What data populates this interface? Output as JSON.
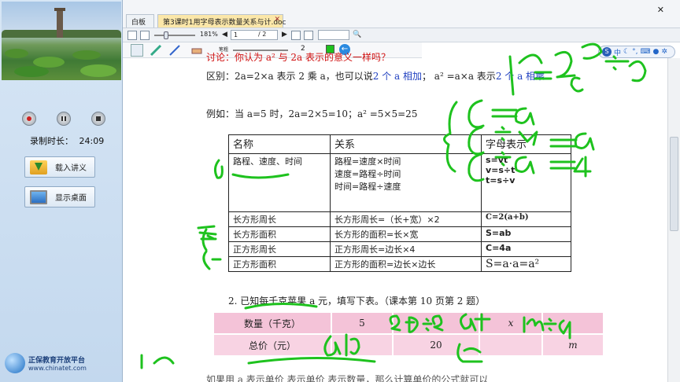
{
  "left_panel": {
    "rec_time_label": "录制时长：",
    "rec_time_value": "24:09",
    "load_button": "载入讲义",
    "desktop_button": "显示桌面",
    "logo_title": "正保教育开放平台",
    "logo_url": "www.chinatet.com"
  },
  "tabs": [
    {
      "label": "白板"
    },
    {
      "label": "第3课时1用字母表示数量关系与计.doc"
    }
  ],
  "toolbar": {
    "zoom": "181%",
    "page_current": "1",
    "page_total": "/ 2",
    "pen_size": "2",
    "small_label": "笔粗"
  },
  "ime": {
    "label": "中"
  },
  "doc": {
    "discussion": "讨论：你认为 a² 与 2a 表示的意义一样吗？",
    "diff_prefix": "区别：2a=2×a 表示 2 乘 a，也可以说",
    "diff_blue": "2 个 a 相加",
    "diff_mid": "；   a² =a×a 表示",
    "diff_blue2": "2 个 a 相乘",
    "example": "例如：当 a=5 时，2a=2×5=10；a² =5×5=25",
    "table_headers": [
      "名称",
      "关系",
      "字母表示"
    ],
    "rows": [
      {
        "name": "路程、速度、时间",
        "rel": [
          "路程=速度×时间",
          "速度=路程÷时间",
          "时间=路程÷速度"
        ],
        "formula": [
          "s=vt",
          "v=s÷t",
          "t=s÷v"
        ]
      },
      {
        "name": "长方形周长",
        "rel": [
          "长方形周长=（长+宽）×2"
        ],
        "formula": [
          "C=2(a+b)"
        ]
      },
      {
        "name": "长方形面积",
        "rel": [
          "长方形的面积=长×宽"
        ],
        "formula": [
          "S=ab"
        ]
      },
      {
        "name": "正方形周长",
        "rel": [
          "正方形周长=边长×4"
        ],
        "formula": [
          "C=4a"
        ]
      },
      {
        "name": "正方形面积",
        "rel": [
          "正方形的面积=边长×边长"
        ],
        "formula": [
          "S=a·a=a²"
        ]
      }
    ],
    "q2": "2.  已知每千克苹果 a 元，填写下表。（课本第 10 页第 2 题）",
    "price_table": [
      [
        "数量（千克）",
        "5",
        "",
        "x",
        ""
      ],
      [
        "总价（元）",
        "",
        "20",
        "",
        "m"
      ]
    ],
    "bottom_line": "如果用 a 表示单价    表示单价    表示数量，那么计算单价的公式就可以"
  },
  "ink": {
    "color": "#1ec21e",
    "notes": [
      "C=4a",
      "C÷4=a",
      "C÷a=4",
      "a²=5²a",
      "m÷a",
      "5a",
      "a元",
      "20÷a"
    ]
  }
}
